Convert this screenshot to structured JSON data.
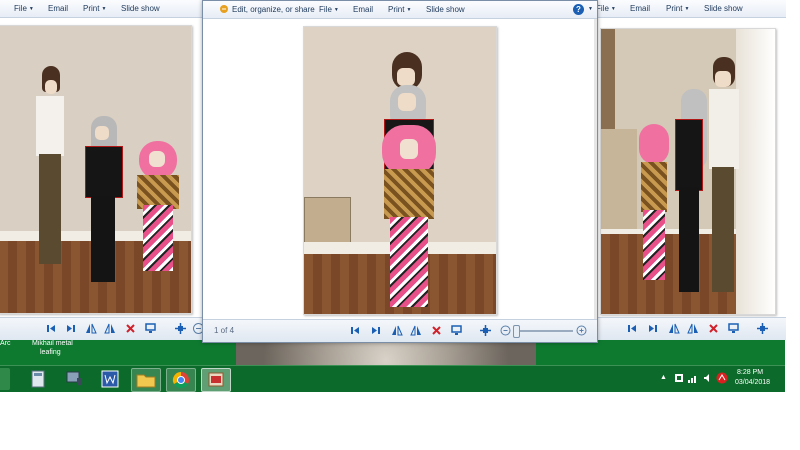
{
  "window_left": {
    "menu": {
      "file": "File",
      "email": "Email",
      "print": "Print",
      "slideshow": "Slide show"
    }
  },
  "window_center": {
    "menu": {
      "edit": "Edit, organize, or share",
      "file": "File",
      "email": "Email",
      "print": "Print",
      "slideshow": "Slide show"
    },
    "status": "1 of 4"
  },
  "window_right": {
    "menu": {
      "file": "File",
      "email": "Email",
      "print": "Print",
      "slideshow": "Slide show"
    }
  },
  "desktop": {
    "label_arc": "Arc",
    "label_mikhail": "Mikhail metal",
    "label_leafing": "leafing"
  },
  "taskbar": {
    "time": "8:28 PM",
    "date": "03/04/2018",
    "accent": "#0c6b2a"
  },
  "icons": [
    "previous-icon",
    "next-icon",
    "rotate-ccw-icon",
    "rotate-cw-icon",
    "delete-icon",
    "slideshow-icon",
    "fit-icon",
    "zoom-out-icon",
    "zoom-in-icon",
    "help-icon"
  ]
}
